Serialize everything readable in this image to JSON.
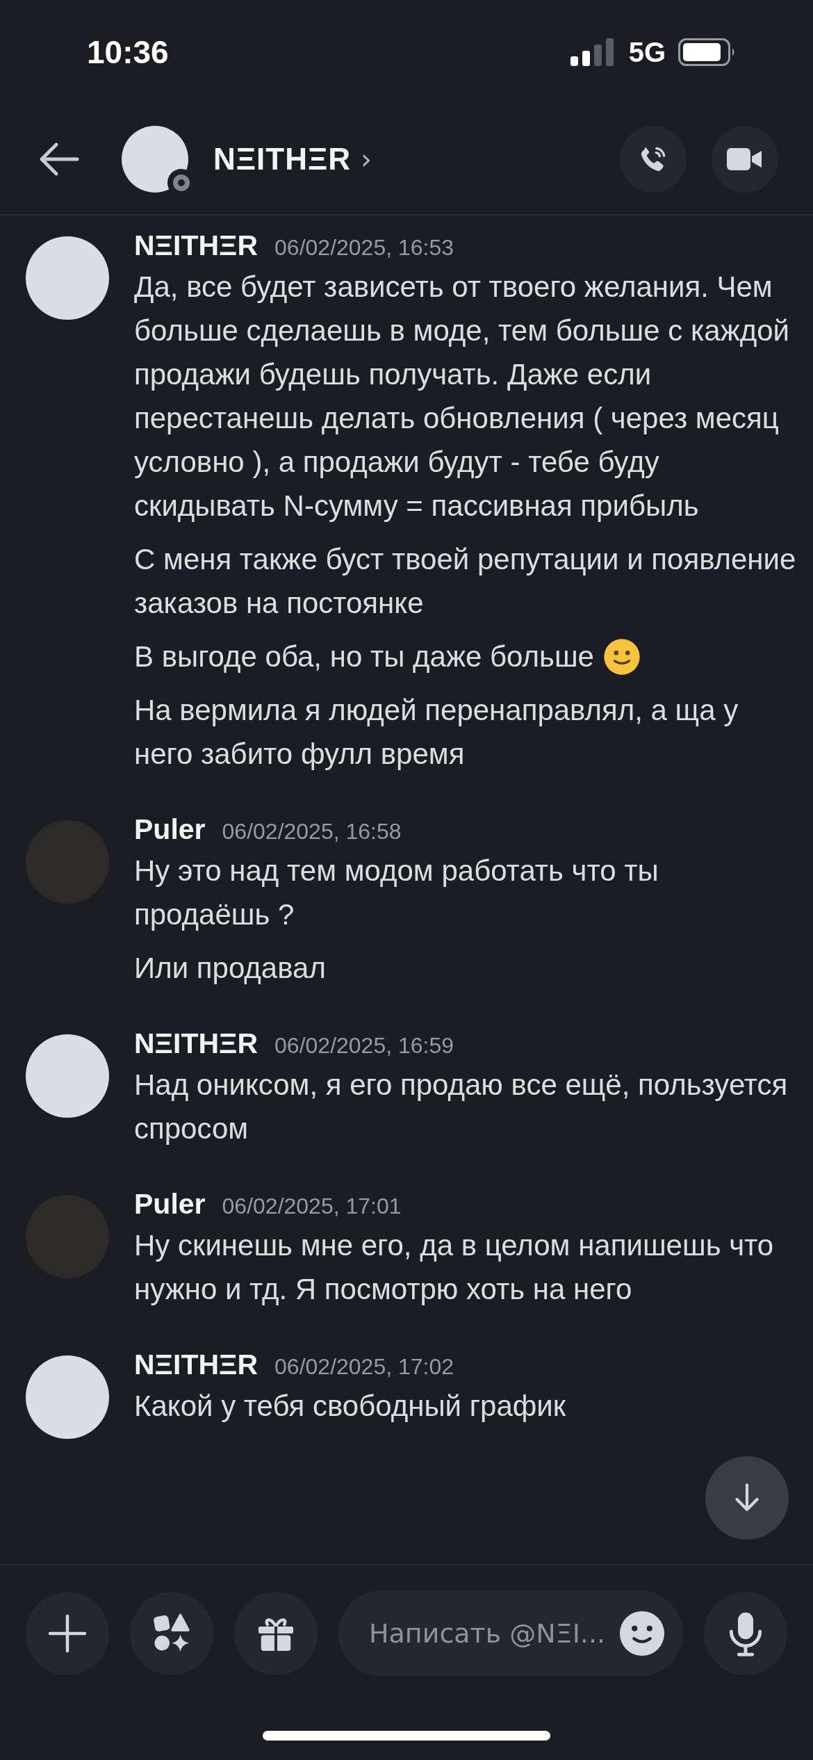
{
  "status_bar": {
    "time": "10:36",
    "network": "5G"
  },
  "header": {
    "title": "NΞITHΞR",
    "chevron": "›",
    "online": false
  },
  "messages": [
    {
      "author": "NΞITHΞR",
      "kind": "light",
      "timestamp": "06/02/2025, 16:53",
      "lines": [
        {
          "text": "Да, все будет зависеть от твоего желания. Чем больше сделаешь в моде, тем больше с каждой продажи будешь получать. Даже если перестанешь делать обновления ( через месяц условно ), а продажи будут - тебе буду скидывать N-сумму = пассивная прибыль",
          "smiley": false
        },
        {
          "text": "С меня также буст твоей репутации и появление заказов на постоянке",
          "smiley": false
        },
        {
          "text": "В выгоде оба, но ты даже больше",
          "smiley": true
        },
        {
          "text": "На вермила я людей перенаправлял, а ща у него забито фулл время",
          "smiley": false
        }
      ]
    },
    {
      "author": "Puler",
      "kind": "dark",
      "timestamp": "06/02/2025, 16:58",
      "lines": [
        {
          "text": "Ну это над тем модом работать что ты продаёшь ?",
          "smiley": false
        },
        {
          "text": "Или продавал",
          "smiley": false
        }
      ]
    },
    {
      "author": "NΞITHΞR",
      "kind": "light",
      "timestamp": "06/02/2025, 16:59",
      "lines": [
        {
          "text": "Над ониксом, я его продаю все ещё, пользуется спросом",
          "smiley": false
        }
      ]
    },
    {
      "author": "Puler",
      "kind": "dark",
      "timestamp": "06/02/2025, 17:01",
      "lines": [
        {
          "text": "Ну скинешь мне его,  да в целом напишешь что нужно и тд. Я посмотрю хоть на него",
          "smiley": false
        }
      ]
    },
    {
      "author": "NΞITHΞR",
      "kind": "light",
      "timestamp": "06/02/2025, 17:02",
      "lines": [
        {
          "text": "Какой у тебя свободный график",
          "smiley": false
        }
      ]
    }
  ],
  "composer": {
    "placeholder": "Написать @NΞI..."
  }
}
